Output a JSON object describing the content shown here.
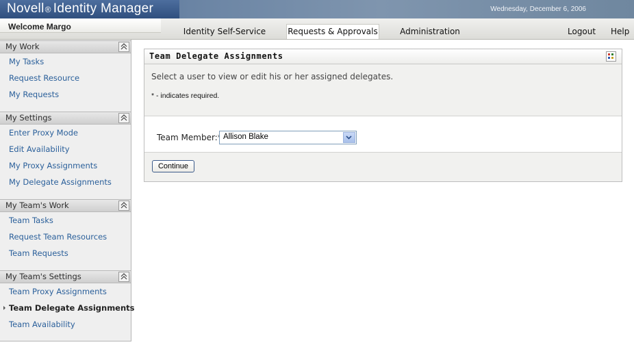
{
  "app": {
    "brand": "Novell",
    "registered": "®",
    "product": "Identity Manager",
    "date": "Wednesday, December 6, 2006",
    "welcome": "Welcome Margo"
  },
  "nav": {
    "tabs": [
      {
        "label": "Identity Self-Service",
        "active": false
      },
      {
        "label": "Requests & Approvals",
        "active": true
      },
      {
        "label": "Administration",
        "active": false
      }
    ],
    "links": [
      {
        "label": "Logout"
      },
      {
        "label": "Help"
      }
    ]
  },
  "sidebar": {
    "sections": [
      {
        "title": "My Work",
        "items": [
          "My Tasks",
          "Request Resource",
          "My Requests"
        ]
      },
      {
        "title": "My Settings",
        "items": [
          "Enter Proxy Mode",
          "Edit Availability",
          "My Proxy Assignments",
          "My Delegate Assignments"
        ]
      },
      {
        "title": "My Team's Work",
        "items": [
          "Team Tasks",
          "Request Team Resources",
          "Team Requests"
        ]
      },
      {
        "title": "My Team's Settings",
        "items": [
          "Team Proxy Assignments",
          "Team Delegate Assignments",
          "Team Availability"
        ]
      }
    ],
    "current": "Team Delegate Assignments"
  },
  "panel": {
    "title": "Team Delegate Assignments",
    "instruction": "Select a user to view or edit his or her assigned delegates.",
    "required_note": "* - indicates required.",
    "team_member_label": "Team Member:*",
    "team_member_value": "Allison Blake",
    "continue_label": "Continue"
  },
  "colors": {
    "link": "#2a5f9a",
    "banner": "#3f5f8a"
  },
  "icons": [
    "collapse-icon",
    "chevron-down-icon",
    "help-icon"
  ]
}
